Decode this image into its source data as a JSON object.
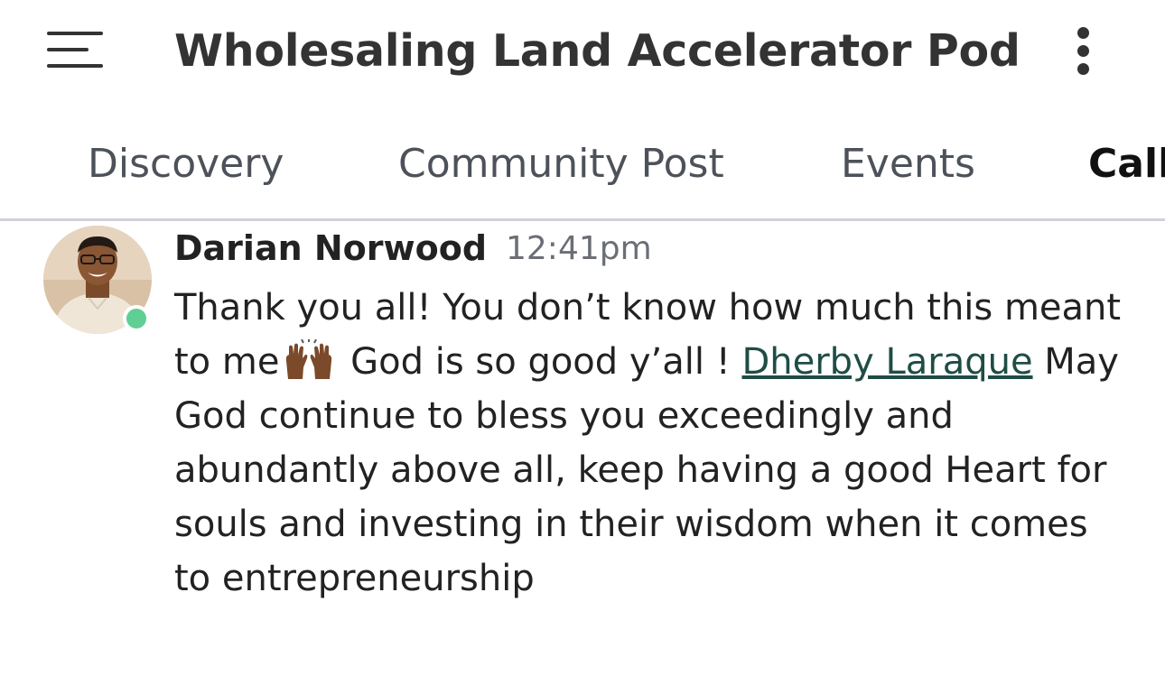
{
  "header": {
    "title": "Wholesaling Land Accelerator Pod",
    "menu_icon": "hamburger-menu-icon",
    "more_icon": "vertical-ellipsis-icon"
  },
  "tabs": [
    {
      "label": "Discovery",
      "active": false
    },
    {
      "label": "Community Post",
      "active": false
    },
    {
      "label": "Events",
      "active": false
    },
    {
      "label": "Call",
      "active": true
    }
  ],
  "message": {
    "author": "Darian Norwood",
    "time": "12:41pm",
    "online": true,
    "text_part1": "Thank you all! You don’t know how much this meant to me",
    "emoji": "🙌🏾",
    "text_part2": " God is so good y’all ! ",
    "mention": "Dherby Laraque",
    "text_part3": " May God continue to bless you exceedingly and abundantly above all, keep having a good Heart for souls and investing in their wisdom when it comes to entrepreneurship"
  },
  "colors": {
    "online": "#5fcf94",
    "mention": "#1f4d45",
    "divider": "#cfd2d6",
    "active_tab": "#111111",
    "inactive_tab": "#4d525a"
  }
}
